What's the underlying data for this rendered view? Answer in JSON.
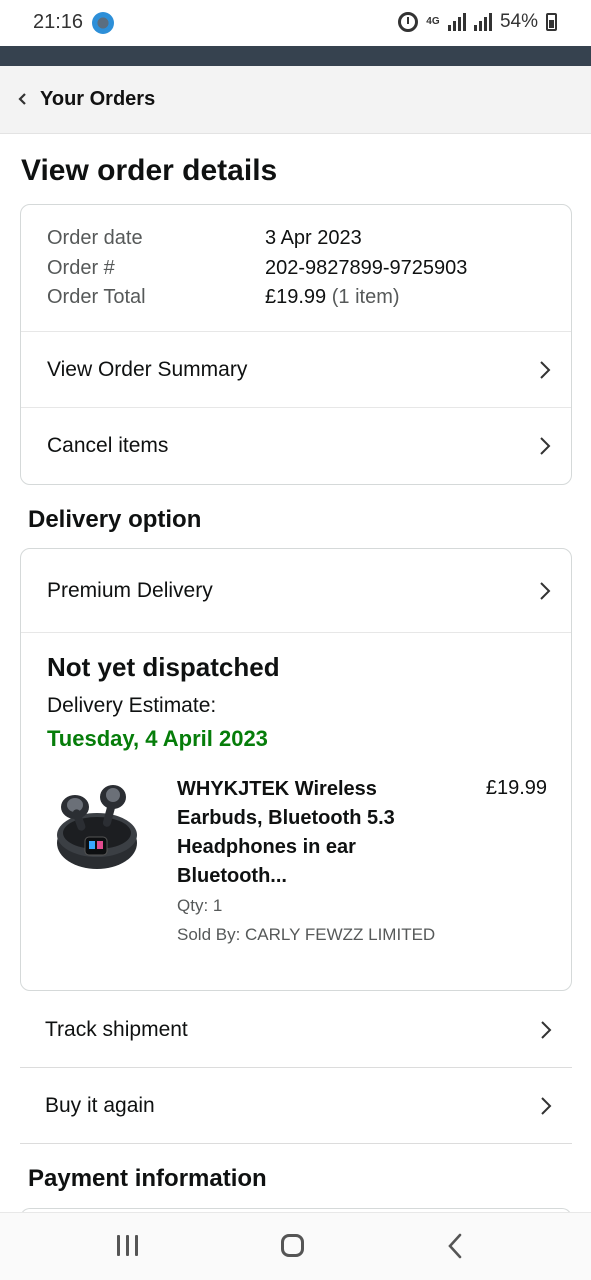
{
  "status_bar": {
    "time": "21:16",
    "network": "4G",
    "battery": "54%",
    "icons": [
      "app-notification-icon",
      "alarm-icon",
      "signal-icon",
      "battery-icon"
    ]
  },
  "breadcrumb": {
    "label": "Your Orders",
    "icon": "chevron-left-icon"
  },
  "page_title": "View order details",
  "order_summary": {
    "date_label": "Order date",
    "date_value": "3 Apr 2023",
    "number_label": "Order #",
    "number_value": "202-9827899-9725903",
    "total_label": "Order Total",
    "total_value": "£19.99",
    "total_items": "(1 item)",
    "view_summary_label": "View Order Summary",
    "cancel_items_label": "Cancel items"
  },
  "delivery": {
    "section_title": "Delivery option",
    "option_label": "Premium Delivery",
    "status": "Not yet dispatched",
    "estimate_label": "Delivery Estimate:",
    "estimate_date": "Tuesday, 4 April 2023",
    "estimate_color": "#067d0a",
    "item": {
      "title": "WHYKJTEK Wireless Earbuds, Bluetooth 5.3 Headphones in ear Bluetooth...",
      "price": "£19.99",
      "qty": "Qty: 1",
      "seller": "Sold By: CARLY FEWZZ LIMITED",
      "image": "earbuds-product-image"
    }
  },
  "actions": {
    "track_label": "Track shipment",
    "buy_again_label": "Buy it again"
  },
  "payment": {
    "section_title": "Payment information"
  },
  "android_nav": {
    "icons": [
      "recents-icon",
      "home-icon",
      "back-icon"
    ]
  }
}
